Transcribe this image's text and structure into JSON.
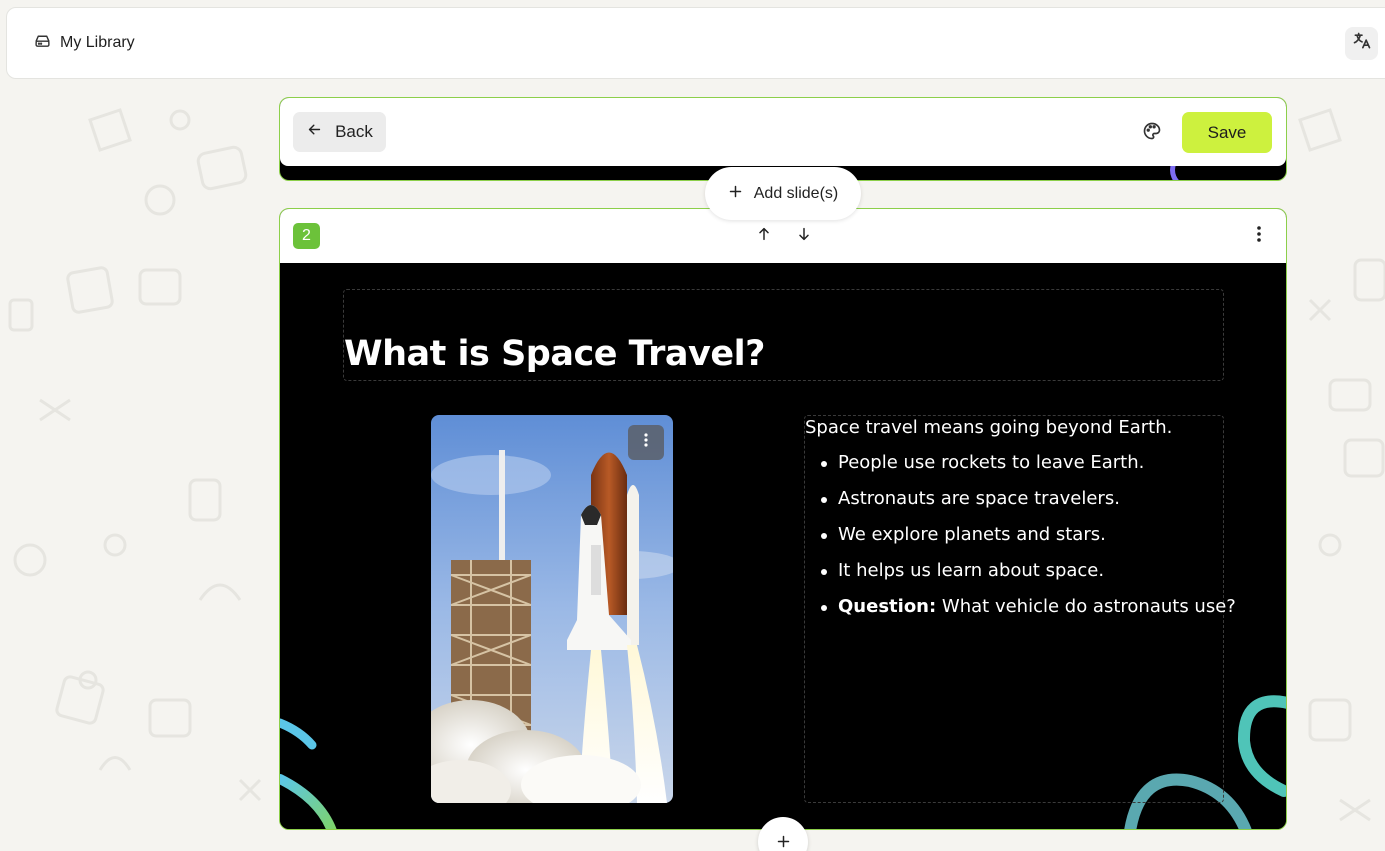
{
  "topbar": {
    "library_label": "My Library",
    "library_icon": "drive-icon",
    "translate_icon": "translate-icon"
  },
  "editor": {
    "back_label": "Back",
    "back_icon": "arrow-left-icon",
    "theme_icon": "palette-icon",
    "save_label": "Save",
    "add_slide_label": "Add slide(s)"
  },
  "slide": {
    "number": "2",
    "title": "What is Space Travel?",
    "intro": "Space travel means going beyond Earth.",
    "bullets": [
      "People use rockets to leave Earth.",
      "Astronauts are space travelers.",
      "We explore planets and stars.",
      "It helps us learn about space."
    ],
    "question_label": "Question:",
    "question_text": " What vehicle do astronauts use?",
    "image_subject": "space shuttle launch"
  },
  "colors": {
    "accent": "#cdf13e",
    "slide_number_bg": "#6cc23a",
    "card_border": "#8ccf4a",
    "slide_bg": "#000000"
  }
}
